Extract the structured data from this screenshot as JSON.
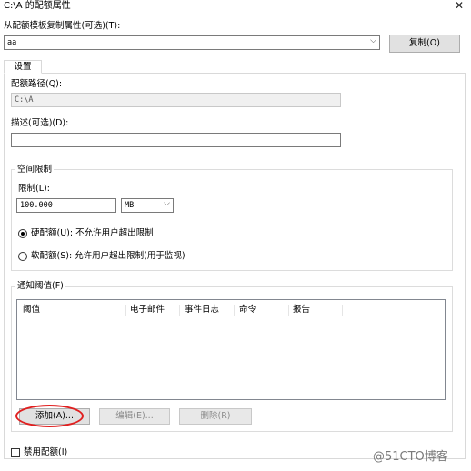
{
  "window": {
    "title": "C:\\A 的配额属性",
    "close_glyph": "✕"
  },
  "template": {
    "label": "从配额模板复制属性(可选)(T):",
    "value": "aa",
    "copy_button": "复制(O)"
  },
  "tabs": [
    {
      "label": "设置"
    }
  ],
  "settings": {
    "path_label": "配额路径(Q):",
    "path_value": "C:\\A",
    "description_label": "描述(可选)(D):",
    "description_value": ""
  },
  "space_limit": {
    "group_label": "空间限制",
    "limit_label": "限制(L):",
    "limit_value": "100.000",
    "unit_value": "MB",
    "hard_label": "硬配额(U): 不允许用户超出限制",
    "soft_label": "软配额(S): 允许用户超出限制(用于监视)",
    "selected": "hard"
  },
  "notification": {
    "group_label": "通知阈值(F)",
    "columns": [
      "阈值",
      "电子邮件",
      "事件日志",
      "命令",
      "报告"
    ],
    "rows": [],
    "add_button": "添加(A)...",
    "edit_button": "编辑(E)...",
    "delete_button": "删除(R)"
  },
  "disable_quota": {
    "label": "禁用配额(I)",
    "checked": false
  },
  "watermark": "@51CTO博客",
  "colors": {
    "annotation_red": "#e01f1f"
  }
}
